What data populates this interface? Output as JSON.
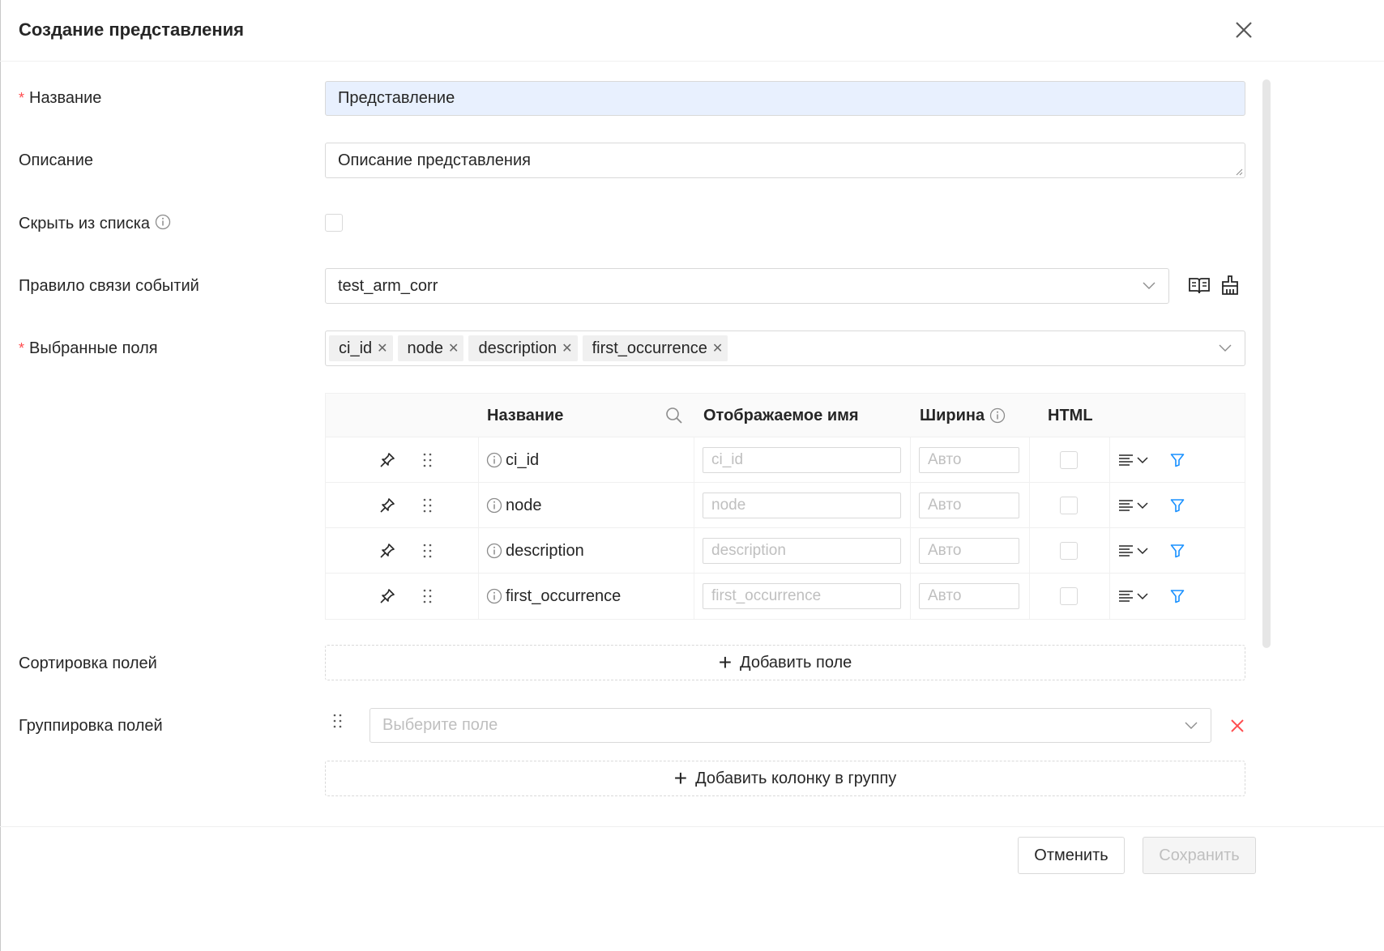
{
  "dialog": {
    "title": "Создание представления"
  },
  "form": {
    "name_label": "Название",
    "name_value": "Представление",
    "description_label": "Описание",
    "description_value": "Описание представления",
    "hide_label": "Скрыть из списка",
    "hide_checked": false,
    "rule_label": "Правило связи событий",
    "rule_value": "test_arm_corr",
    "fields_label": "Выбранные поля",
    "selected_tags": [
      "ci_id",
      "node",
      "description",
      "first_occurrence"
    ],
    "sort_label": "Сортировка полей",
    "sort_add_label": "Добавить поле",
    "group_label": "Группировка полей",
    "group_placeholder": "Выберите поле",
    "group_add_label": "Добавить колонку в группу"
  },
  "table": {
    "columns": {
      "name": "Название",
      "display_name": "Отображаемое имя",
      "width": "Ширина",
      "html": "HTML"
    },
    "rows": [
      {
        "name": "ci_id",
        "display_placeholder": "ci_id",
        "width_placeholder": "Авто",
        "html": false
      },
      {
        "name": "node",
        "display_placeholder": "node",
        "width_placeholder": "Авто",
        "html": false
      },
      {
        "name": "description",
        "display_placeholder": "description",
        "width_placeholder": "Авто",
        "html": false
      },
      {
        "name": "first_occurrence",
        "display_placeholder": "first_occurrence",
        "width_placeholder": "Авто",
        "html": false
      }
    ]
  },
  "footer": {
    "cancel_label": "Отменить",
    "save_label": "Сохранить"
  },
  "colors": {
    "accent": "#1890ff",
    "danger": "#ff4d4f",
    "filled_input": "#e8f0fe"
  }
}
